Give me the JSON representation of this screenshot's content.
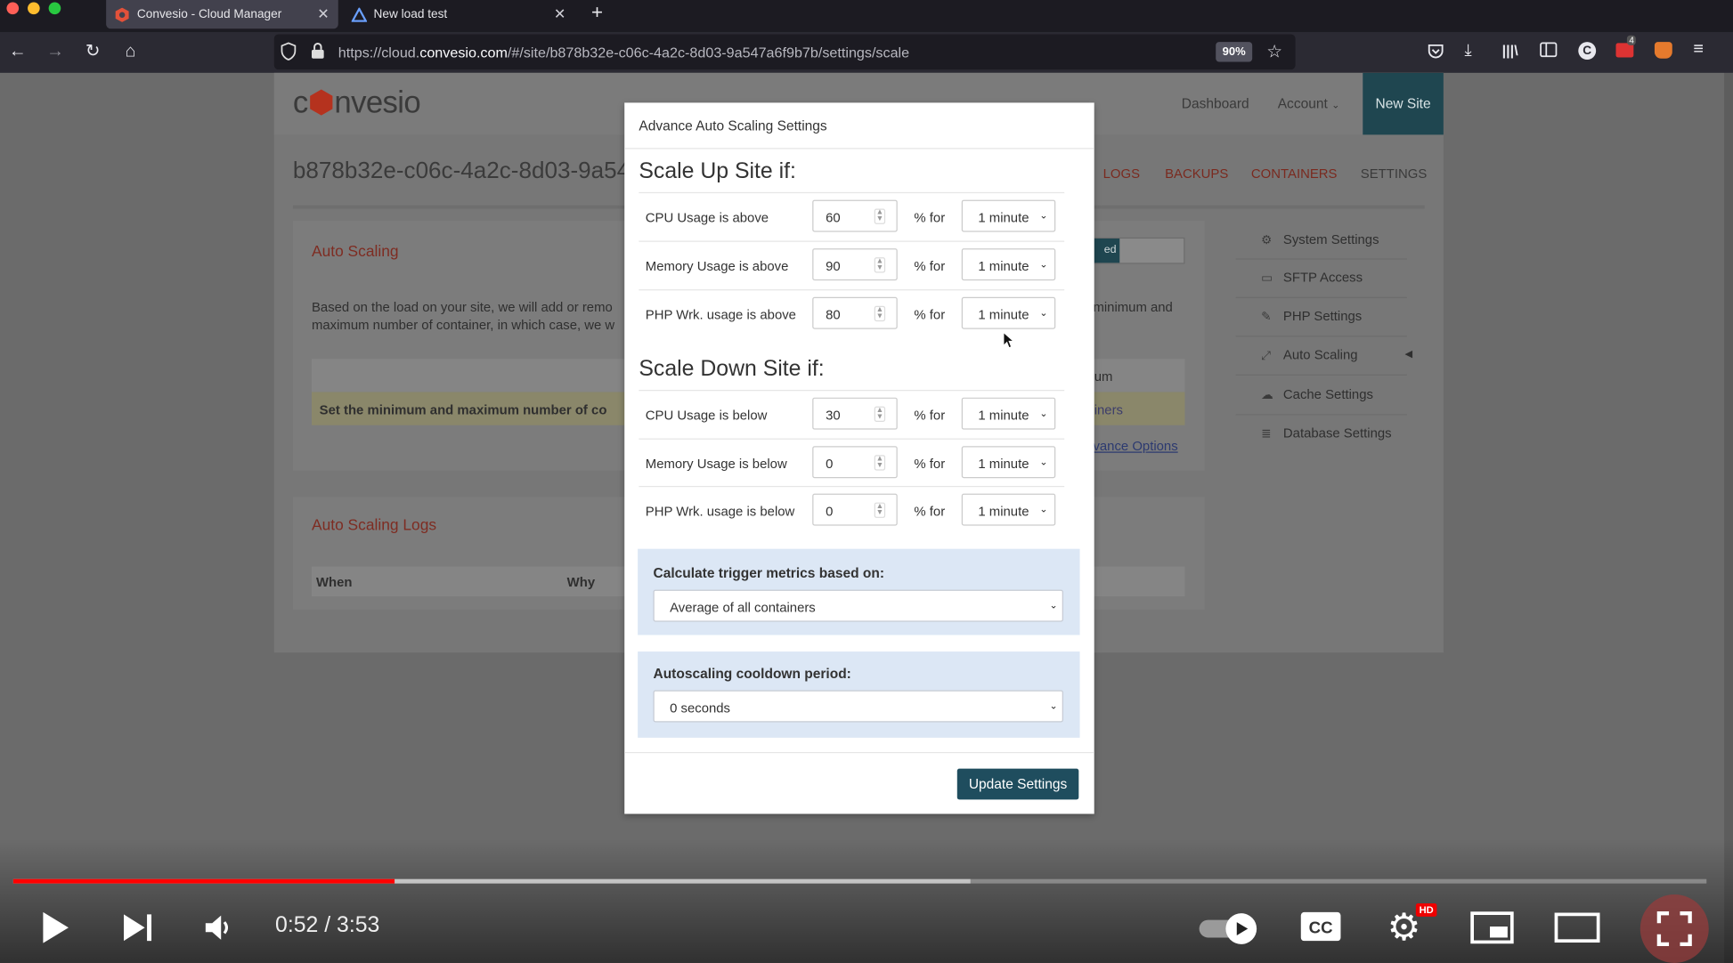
{
  "browser": {
    "tabs": [
      {
        "label": "Convesio - Cloud Manager",
        "active": true
      },
      {
        "label": "New load test",
        "active": false
      }
    ],
    "url_prefix": "https://cloud.",
    "url_domain": "convesio.com",
    "url_suffix": "/#/site/b878b32e-c06c-4a2c-8d03-9a547a6f9b7b/settings/scale",
    "zoom": "90%",
    "badge_count": "4"
  },
  "site": {
    "logo_pre": "c",
    "logo_mid": "nvesio",
    "nav": [
      "Dashboard",
      "Account"
    ],
    "new_site_label": "New Site",
    "site_id": "b878b32e-c06c-4a2c-8d03-9a54",
    "tabs": [
      "LOGS",
      "BACKUPS",
      "CONTAINERS",
      "SETTINGS"
    ],
    "auto_scaling_title": "Auto Scaling",
    "auto_scaling_text_1": "Based on the load on your site, we will add or remo",
    "auto_scaling_text_2": "maximum number of container, in which case, we w",
    "auto_scaling_text_r": "minimum and",
    "enabled_fragment": "ed",
    "table_fragment": "um",
    "notice": "Set the minimum and maximum number of co",
    "notice_r": "iners",
    "advance_options": "vance Options",
    "logs_title": "Auto Scaling Logs",
    "logs_cols": [
      "When",
      "Why"
    ],
    "sidebar": [
      "System Settings",
      "SFTP Access",
      "PHP Settings",
      "Auto Scaling",
      "Cache Settings",
      "Database Settings"
    ]
  },
  "modal": {
    "title": "Advance Auto Scaling Settings",
    "scale_up_heading": "Scale Up Site if:",
    "scale_down_heading": "Scale Down Site if:",
    "pct_for": "% for",
    "scale_up": [
      {
        "label": "CPU Usage is above",
        "value": "60",
        "period": "1 minute"
      },
      {
        "label": "Memory Usage is above",
        "value": "90",
        "period": "1 minute"
      },
      {
        "label": "PHP Wrk. usage is above",
        "value": "80",
        "period": "1 minute"
      }
    ],
    "scale_down": [
      {
        "label": "CPU Usage is below",
        "value": "30",
        "period": "1 minute"
      },
      {
        "label": "Memory Usage is below",
        "value": "0",
        "period": "1 minute"
      },
      {
        "label": "PHP Wrk. usage is below",
        "value": "0",
        "period": "1 minute"
      }
    ],
    "calc_label": "Calculate trigger metrics based on:",
    "calc_value": "Average of all containers",
    "cooldown_label": "Autoscaling cooldown period:",
    "cooldown_value": "0 seconds",
    "update_button": "Update Settings"
  },
  "player": {
    "time": "0:52 / 3:53",
    "played_fraction": 0.225,
    "buffered_fraction": 0.565,
    "hd_badge": "HD"
  }
}
